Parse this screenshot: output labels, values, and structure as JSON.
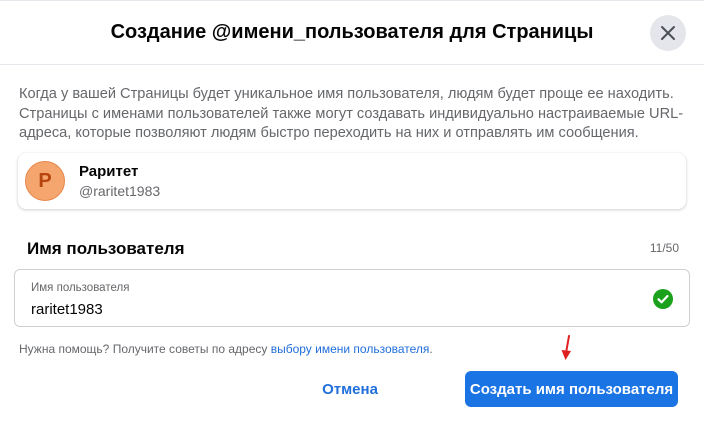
{
  "dialog": {
    "title": "Создание @имени_пользователя для Страницы",
    "description": "Когда у вашей Страницы будет уникальное имя пользователя, людям будет проще ее находить. Страницы с именами пользователей также могут создавать индивидуально настраиваемые URL-адреса, которые позволяют людям быстро переходить на них и отправлять им сообщения."
  },
  "profile": {
    "avatar_letter": "Р",
    "name": "Раритет",
    "handle": "@raritet1983"
  },
  "username_section": {
    "label": "Имя пользователя",
    "counter": "11/50",
    "field_label": "Имя пользователя",
    "value": "raritet1983",
    "status_icon": "check-circle-icon"
  },
  "help": {
    "text": "Нужна помощь? Получите советы по адресу ",
    "link": "выбору имени пользователя",
    "suffix": "."
  },
  "actions": {
    "cancel": "Отмена",
    "create": "Создать имя пользователя"
  },
  "colors": {
    "primary": "#1b74e4",
    "link": "#216fdb",
    "success": "#1ca11c",
    "annotation_arrow": "#e02020"
  }
}
